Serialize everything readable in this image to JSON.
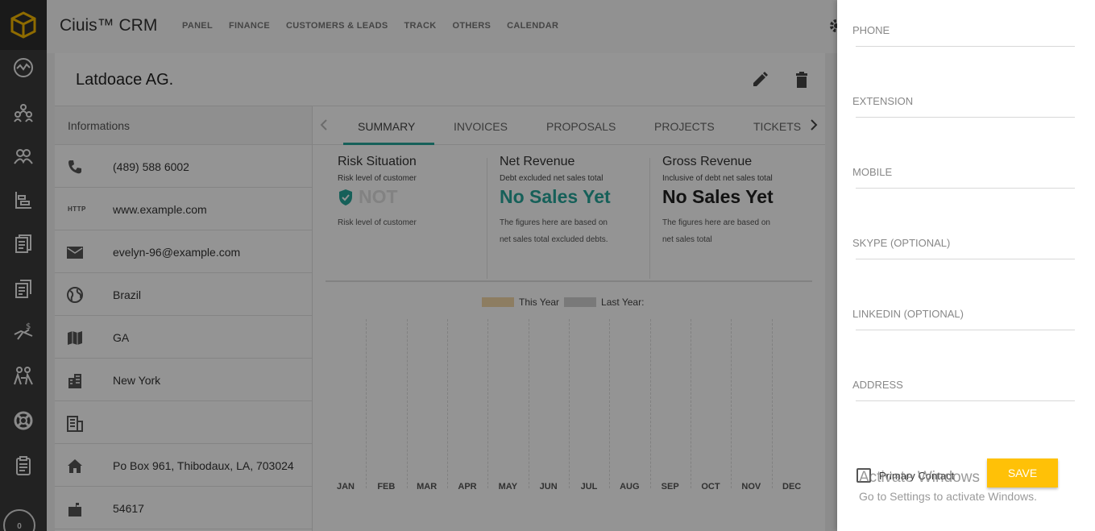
{
  "app": {
    "brand": "Ciuis™ CRM",
    "nav": [
      "PANEL",
      "FINANCE",
      "CUSTOMERS & LEADS",
      "TRACK",
      "OTHERS",
      "CALENDAR"
    ],
    "notification_count": "0"
  },
  "sidebar_icons": [
    "dashboard-icon",
    "customers-icon",
    "leads-icon",
    "projects-icon",
    "invoices-icon",
    "proposals-icon",
    "expenses-icon",
    "staff-icon",
    "support-icon",
    "tasks-icon"
  ],
  "customer": {
    "name": "Latdoace AG."
  },
  "informations": {
    "title": "Informations",
    "http_label": "HTTP",
    "phone": "(489) 588 6002",
    "website": "www.example.com",
    "email": "evelyn-96@example.com",
    "country": "Brazil",
    "state": "GA",
    "city": "New York",
    "company_extra": "",
    "address": "Po Box 961, Thibodaux, LA, 703024",
    "zip": "54617"
  },
  "tabs": [
    "SUMMARY",
    "INVOICES",
    "PROPOSALS",
    "PROJECTS",
    "TICKETS"
  ],
  "summary": {
    "risk": {
      "title": "Risk Situation",
      "subtitle": "Risk level of customer",
      "value": "NOT",
      "desc": "Risk level of customer"
    },
    "net": {
      "title": "Net Revenue",
      "subtitle": "Debt excluded net sales total",
      "value": "No Sales Yet",
      "desc1": "The figures here are based on",
      "desc2": "net sales total excluded debts."
    },
    "gross": {
      "title": "Gross Revenue",
      "subtitle": "Inclusive of debt net sales total",
      "value": "No Sales Yet",
      "desc1": "The figures here are based on",
      "desc2": "net sales total"
    }
  },
  "colors": {
    "this_year": "#f3d8a8",
    "last_year": "#d0d0d0",
    "accent": "#26a69a",
    "save": "#ffc107"
  },
  "chart_data": {
    "type": "bar",
    "categories": [
      "JAN",
      "FEB",
      "MAR",
      "APR",
      "MAY",
      "JUN",
      "JUL",
      "AUG",
      "SEP",
      "OCT",
      "NOV",
      "DEC"
    ],
    "series": [
      {
        "name": "This Year",
        "values": [
          0,
          0,
          0,
          0,
          0,
          0,
          0,
          0,
          0,
          0,
          0,
          0
        ]
      },
      {
        "name": "Last Year:",
        "values": [
          0,
          0,
          0,
          0,
          0,
          0,
          0,
          0,
          0,
          0,
          0,
          0
        ]
      }
    ],
    "legend": "top-center",
    "grid": true
  },
  "contact_form": {
    "fields": [
      "PHONE",
      "EXTENSION",
      "MOBILE",
      "SKYPE (OPTIONAL)",
      "LINKEDIN (OPTIONAL)",
      "ADDRESS"
    ],
    "primary_contact_label": "Primary Contact",
    "save_label": "SAVE"
  },
  "watermark": {
    "line1": "Activate Windows",
    "line2": "Go to Settings to activate Windows."
  }
}
